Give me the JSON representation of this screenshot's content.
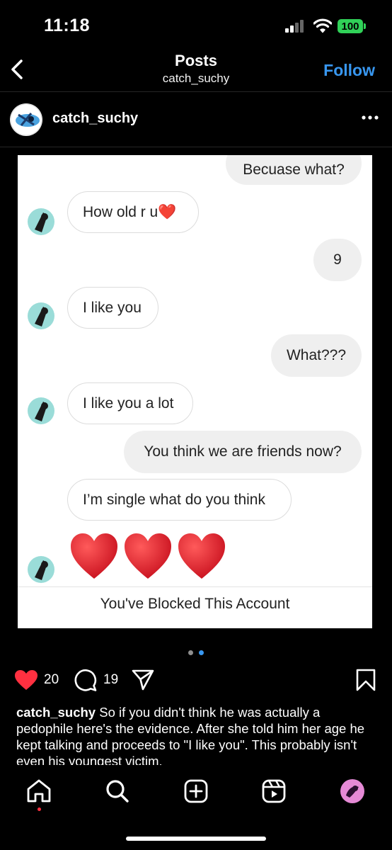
{
  "status_bar": {
    "time": "11:18",
    "battery": "100"
  },
  "header": {
    "title": "Posts",
    "subtitle": "catch_suchy",
    "follow_label": "Follow"
  },
  "post": {
    "author": "catch_suchy",
    "chat": {
      "messages": [
        {
          "side": "sent",
          "text": "Becuase what?"
        },
        {
          "side": "received",
          "text": "How old r u❤️"
        },
        {
          "side": "sent",
          "text": "9"
        },
        {
          "side": "received",
          "text": "I like you"
        },
        {
          "side": "sent",
          "text": "What???"
        },
        {
          "side": "received",
          "text": "I like you a lot"
        },
        {
          "side": "sent",
          "text": "You think we are friends now?"
        },
        {
          "side": "received",
          "text": "I’m single what do you think"
        }
      ],
      "hearts": "❤️❤️❤️",
      "blocked_text": "You've Blocked This Account"
    },
    "carousel": {
      "total": 2,
      "active": 2
    },
    "likes": "20",
    "comments": "19",
    "caption": {
      "username": "catch_suchy",
      "text": "So if you didn't think he was actually a pedophile here's the evidence. After she told him her age he kept talking and proceeds to \"I like you\". This probably isn't even his youngest victim."
    }
  },
  "colors": {
    "accent": "#3897f0",
    "like": "#ff3040",
    "battery": "#30d158"
  },
  "nav": [
    "home-icon",
    "search-icon",
    "create-icon",
    "reels-icon",
    "profile-avatar"
  ]
}
